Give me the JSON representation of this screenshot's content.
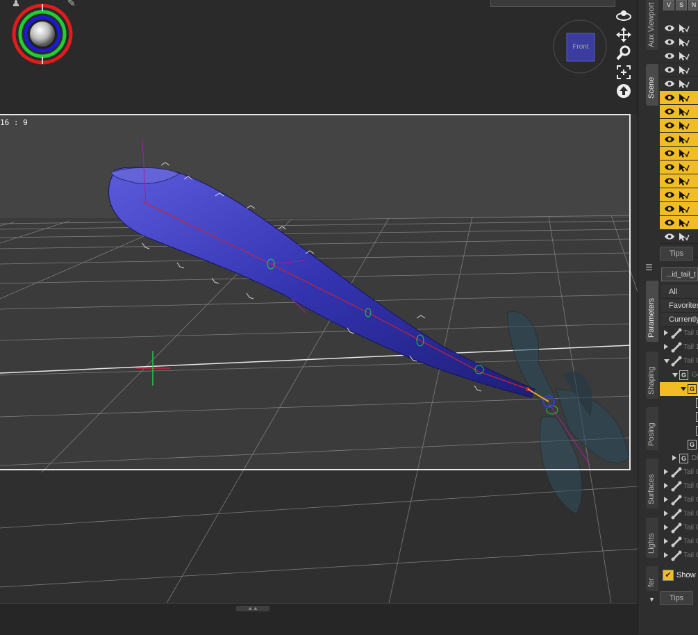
{
  "viewport": {
    "aspect_ratio_label": "16 : 9",
    "camera_cube_label": "Front",
    "camera_dropdown_value": ""
  },
  "nav_tools": [
    "orbit-icon",
    "pan-icon",
    "zoom-icon",
    "frame-icon",
    "reset-icon"
  ],
  "panel": {
    "tabs_top": [
      {
        "id": "aux-viewport",
        "label": "Aux Viewport"
      },
      {
        "id": "scene",
        "label": "Scene"
      }
    ],
    "tabs_bottom": [
      {
        "id": "parameters",
        "label": "Parameters"
      },
      {
        "id": "shaping",
        "label": "Shaping"
      },
      {
        "id": "posing",
        "label": "Posing"
      },
      {
        "id": "surfaces",
        "label": "Surfaces"
      },
      {
        "id": "lights",
        "label": "Lights"
      },
      {
        "id": "render",
        "label": "fer"
      }
    ],
    "scene_header": {
      "visible": "V",
      "selectable": "S",
      "third": "N"
    },
    "tips_top": "Tips",
    "tips_bottom": "Tips",
    "param_search": "...id_tail_t",
    "filters": [
      {
        "label": "All"
      },
      {
        "label": "Favorites"
      },
      {
        "label": "Currently"
      }
    ],
    "tree": [
      {
        "label": "Tail C",
        "icon": "bone",
        "expand": "right",
        "indent": 0,
        "selected": false
      },
      {
        "label": "Tail 1",
        "icon": "bone",
        "expand": "right",
        "indent": 0,
        "selected": false
      },
      {
        "label": "Tail C",
        "icon": "bone",
        "expand": "down",
        "indent": 0,
        "selected": false
      },
      {
        "label": "Ge",
        "icon": "group",
        "expand": "down",
        "indent": 1,
        "selected": false
      },
      {
        "label": "T",
        "icon": "group",
        "expand": "down",
        "indent": 2,
        "selected": true
      },
      {
        "label": "",
        "icon": "group",
        "expand": "none",
        "indent": 3,
        "selected": false
      },
      {
        "label": "",
        "icon": "group",
        "expand": "none",
        "indent": 3,
        "selected": false
      },
      {
        "label": "",
        "icon": "group",
        "expand": "none",
        "indent": 3,
        "selected": false
      },
      {
        "label": "C",
        "icon": "group",
        "expand": "none",
        "indent": 2,
        "selected": false
      },
      {
        "label": "Dis",
        "icon": "group",
        "expand": "right",
        "indent": 1,
        "selected": false
      },
      {
        "label": "Tail C",
        "icon": "bone",
        "expand": "right",
        "indent": 0,
        "selected": false
      },
      {
        "label": "Tail C",
        "icon": "bone",
        "expand": "right",
        "indent": 0,
        "selected": false
      },
      {
        "label": "Tail C",
        "icon": "bone",
        "expand": "right",
        "indent": 0,
        "selected": false
      },
      {
        "label": "Tail C",
        "icon": "bone",
        "expand": "right",
        "indent": 0,
        "selected": false
      },
      {
        "label": "Tail C",
        "icon": "bone",
        "expand": "right",
        "indent": 0,
        "selected": false
      },
      {
        "label": "Tail C",
        "icon": "bone",
        "expand": "right",
        "indent": 0,
        "selected": false
      },
      {
        "label": "Tail C",
        "icon": "bone",
        "expand": "right",
        "indent": 0,
        "selected": false
      }
    ],
    "show_checkbox_label": "Show",
    "scene_rows": [
      {
        "selected": false
      },
      {
        "selected": false
      },
      {
        "selected": false
      },
      {
        "selected": false
      },
      {
        "selected": false
      },
      {
        "selected": true
      },
      {
        "selected": true
      },
      {
        "selected": true
      },
      {
        "selected": true
      },
      {
        "selected": true
      },
      {
        "selected": true
      },
      {
        "selected": true
      },
      {
        "selected": true
      },
      {
        "selected": true
      },
      {
        "selected": true
      },
      {
        "selected": false
      },
      {
        "selected": false
      }
    ]
  },
  "colors": {
    "selection": "#f2bd24",
    "mesh": "#2f2fa8",
    "panel_bg": "#2e2e2e"
  }
}
